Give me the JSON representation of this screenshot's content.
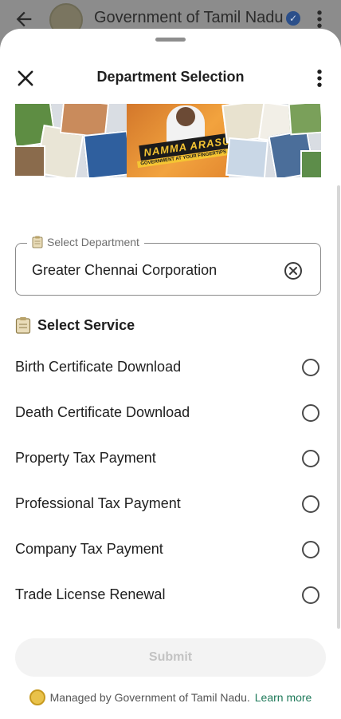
{
  "behind": {
    "title": "Government of Tamil Nadu",
    "icons": [
      "back-arrow-icon",
      "tn-emblem-icon",
      "verified-badge-icon",
      "more-vert-icon"
    ]
  },
  "sheet": {
    "title": "Department Selection",
    "close_icon": "close-icon",
    "more_icon": "more-vert-icon"
  },
  "banner": {
    "logo_text": "NAMMA ARASU",
    "tagline": "GOVERNMENT AT YOUR FINGERTIPS"
  },
  "department": {
    "label": "Select Department",
    "value": "Greater Chennai Corporation",
    "label_icon": "clipboard-icon",
    "clear_icon": "clear-circle-icon"
  },
  "services": {
    "heading": "Select Service",
    "heading_icon": "clipboard-icon",
    "options": [
      {
        "label": "Birth Certificate Download",
        "selected": false
      },
      {
        "label": "Death Certificate Download",
        "selected": false
      },
      {
        "label": "Property Tax Payment",
        "selected": false
      },
      {
        "label": "Professional Tax Payment",
        "selected": false
      },
      {
        "label": "Company Tax Payment",
        "selected": false
      },
      {
        "label": "Trade License Renewal",
        "selected": false
      }
    ]
  },
  "footer": {
    "submit_label": "Submit",
    "managed_text": "Managed by Government of Tamil Nadu.",
    "learn_more": "Learn more",
    "emblem_icon": "tn-emblem-icon"
  },
  "colors": {
    "accent_link": "#1f7a5a",
    "submit_disabled_bg": "#f3f3f3",
    "submit_disabled_text": "#c3c3c3",
    "verified_badge": "#2b4f8a"
  }
}
